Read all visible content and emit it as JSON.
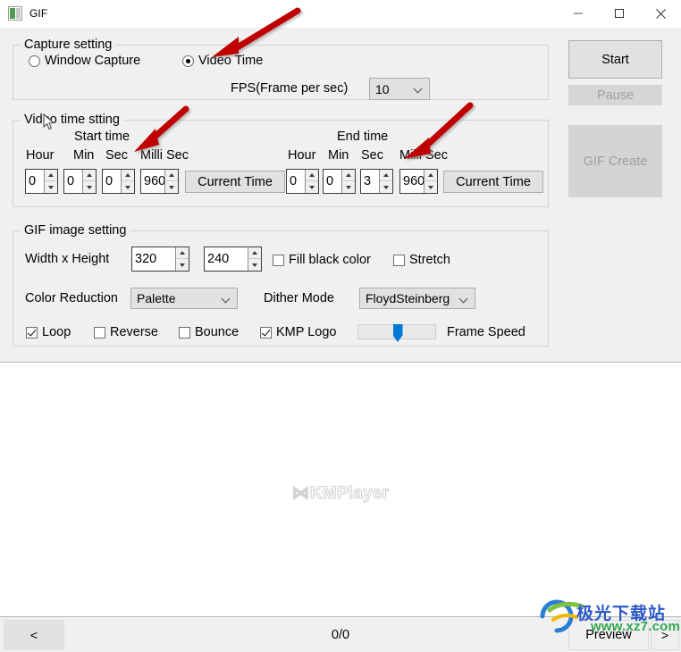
{
  "window": {
    "title": "GIF",
    "icon": "gif-app-icon",
    "controls": {
      "minimize": "minimize-icon",
      "maximize": "maximize-icon",
      "close": "close-icon"
    }
  },
  "capture_setting": {
    "title": "Capture setting",
    "radios": [
      {
        "label": "Window Capture",
        "checked": false
      },
      {
        "label": "Video Time",
        "checked": true
      }
    ],
    "fps": {
      "label": "FPS(Frame per sec)",
      "value": "10"
    }
  },
  "video_time_setting": {
    "title": "Video time stting",
    "start": {
      "section_label": "Start time",
      "column_labels": [
        "Hour",
        "Min",
        "Sec",
        "Milli Sec"
      ],
      "hour": "0",
      "min": "0",
      "sec": "0",
      "milli": "960",
      "current_time_button": "Current Time"
    },
    "end": {
      "section_label": "End time",
      "column_labels": [
        "Hour",
        "Min",
        "Sec",
        "Milli Sec"
      ],
      "hour": "0",
      "min": "0",
      "sec": "3",
      "milli": "960",
      "current_time_button": "Current Time"
    }
  },
  "gif_image_setting": {
    "title": "GIF image setting",
    "size": {
      "label": "Width x Height",
      "width": "320",
      "height": "240"
    },
    "fill_black_color": {
      "label": "Fill black color",
      "checked": false
    },
    "stretch": {
      "label": "Stretch",
      "checked": false
    },
    "color_reduction": {
      "label": "Color Reduction",
      "value": "Palette"
    },
    "dither_mode": {
      "label": "Dither Mode",
      "value": "FloydSteinberg"
    },
    "loop": {
      "label": "Loop",
      "checked": true
    },
    "reverse": {
      "label": "Reverse",
      "checked": false
    },
    "bounce": {
      "label": "Bounce",
      "checked": false
    },
    "kmp_logo": {
      "label": "KMP Logo",
      "checked": true
    },
    "frame_speed": {
      "label": "Frame Speed",
      "position_percent": 50
    }
  },
  "actions": {
    "start": {
      "label": "Start",
      "enabled": true
    },
    "pause": {
      "label": "Pause",
      "enabled": false
    },
    "gif_create": {
      "label": "GIF Create",
      "enabled": false
    }
  },
  "preview": {
    "logo_mark": "⋈",
    "logo_text": "KMPlayer"
  },
  "bottom_bar": {
    "prev_label": "<",
    "frame_counter": "0/0",
    "preview_label": "Preview",
    "next_label": ">"
  },
  "watermark": {
    "chinese": "极光下载站",
    "url": "www.xz7.com"
  },
  "colors": {
    "accent": "#0078d7",
    "annotation_arrow": "#c00000",
    "window_bg": "#f0f0f0",
    "preview_bg": "#ffffff"
  }
}
